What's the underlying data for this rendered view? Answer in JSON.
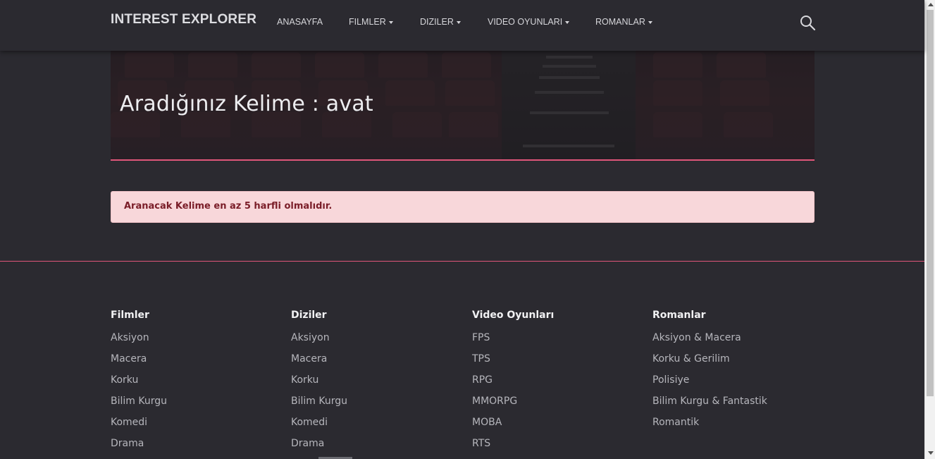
{
  "navbar": {
    "brand": "INTEREST EXPLORER",
    "items": [
      {
        "label": "ANASAYFA",
        "dropdown": false
      },
      {
        "label": "FILMLER",
        "dropdown": true
      },
      {
        "label": "DIZILER",
        "dropdown": true
      },
      {
        "label": "VIDEO OYUNLARI",
        "dropdown": true
      },
      {
        "label": "ROMANLAR",
        "dropdown": true
      }
    ],
    "search_icon": "search-icon"
  },
  "hero": {
    "title": "Aradığınız Kelime : avat"
  },
  "alert": {
    "text": "Aranacak Kelime en az 5 harfli olmalıdır."
  },
  "footer": {
    "columns": [
      {
        "title": "Filmler",
        "links": [
          "Aksiyon",
          "Macera",
          "Korku",
          "Bilim Kurgu",
          "Komedi",
          "Drama"
        ]
      },
      {
        "title": "Diziler",
        "links": [
          "Aksiyon",
          "Macera",
          "Korku",
          "Bilim Kurgu",
          "Komedi",
          "Drama"
        ]
      },
      {
        "title": "Video Oyunları",
        "links": [
          "FPS",
          "TPS",
          "RPG",
          "MMORPG",
          "MOBA",
          "RTS"
        ]
      },
      {
        "title": "Romanlar",
        "links": [
          "Aksiyon & Macera",
          "Korku & Gerilim",
          "Polisiye",
          "Bilim Kurgu & Fantastik",
          "Romantik"
        ]
      }
    ]
  },
  "colors": {
    "background": "#2b2a30",
    "accent": "#e0567a",
    "alert_bg": "#f8d7da",
    "alert_text": "#7a1d28"
  }
}
